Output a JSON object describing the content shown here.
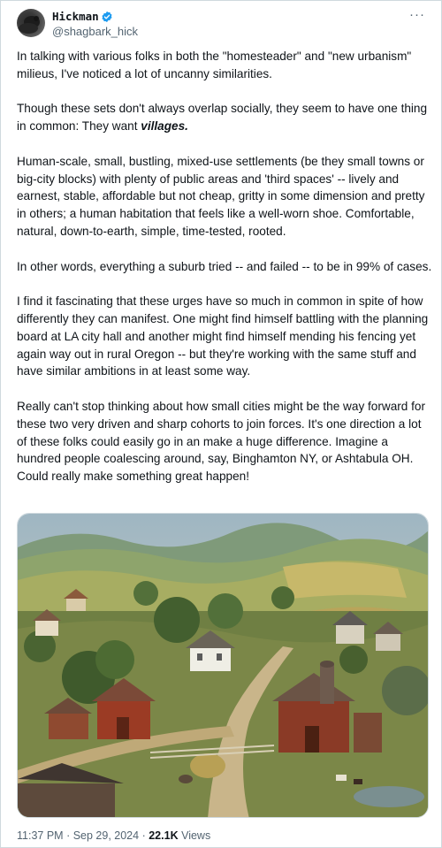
{
  "author": {
    "display_name": "Hickman",
    "handle": "@shagbark_hick",
    "verified": true,
    "verified_color": "#1d9bf0"
  },
  "more_menu_label": "···",
  "tweet": {
    "p1": "In talking with various folks in both the \"homesteader\" and \"new urbanism\" milieus, I've noticed a lot of uncanny similarities.",
    "p2_before": "Though these sets don't always overlap socially, they seem to have one thing in common: They want ",
    "p2_emphasis": "villages.",
    "p3": "Human-scale, small, bustling, mixed-use settlements (be they small towns or big-city blocks) with plenty of public areas and 'third spaces' -- lively and earnest, stable, affordable but not cheap, gritty in some dimension and pretty in others; a human habitation that feels like a well-worn shoe. Comfortable, natural, down-to-earth, simple, time-tested, rooted.",
    "p4": "In other words, everything a suburb tried -- and failed -- to be in 99% of cases.",
    "p5": "I find it fascinating that these urges have so much in common in spite of how differently they can manifest. One might find himself battling with the planning board at LA city hall and another might find himself mending his fencing yet again way out in rural Oregon -- but they're working with the same stuff and have similar ambitions in at least some way.",
    "p6": "Really can't stop thinking about how small cities might be the way forward for these two very driven and sharp cohorts to join forces. It's one direction a lot of these folks could easily go in an make a huge difference. Imagine a hundred people coalescing around, say, Binghamton NY, or Ashtabula OH. Could really make something great happen!"
  },
  "media": {
    "kind": "painting of a rural village with red barns, farmhouses, trees and rolling green hills"
  },
  "footer": {
    "time": "11:37 PM",
    "separator": "·",
    "date": "Sep 29, 2024",
    "views_count": "22.1K",
    "views_label": "Views"
  }
}
